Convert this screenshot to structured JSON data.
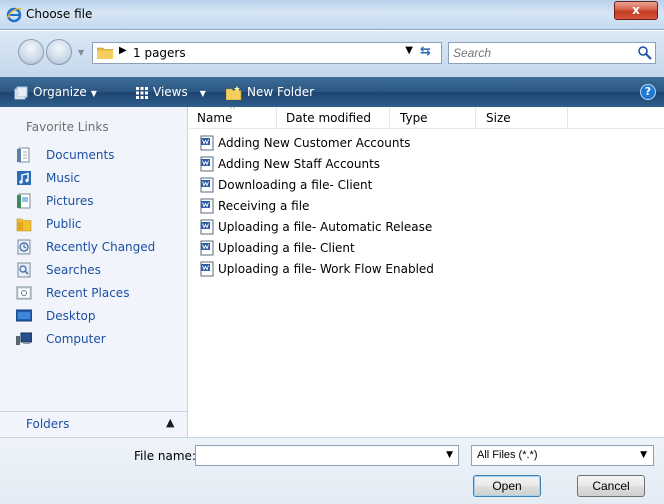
{
  "window": {
    "title": "Choose file",
    "close_label": "x"
  },
  "address": {
    "path": "1 pagers",
    "search_placeholder": "Search"
  },
  "toolbar": {
    "organize": "Organize",
    "views": "Views",
    "new_folder": "New Folder",
    "help": "?"
  },
  "sidebar": {
    "title": "Favorite Links",
    "items": [
      {
        "label": "Documents",
        "icon": "documents-icon"
      },
      {
        "label": "Music",
        "icon": "music-icon"
      },
      {
        "label": "Pictures",
        "icon": "pictures-icon"
      },
      {
        "label": "Public",
        "icon": "public-folder-icon"
      },
      {
        "label": "Recently Changed",
        "icon": "recently-changed-icon"
      },
      {
        "label": "Searches",
        "icon": "searches-icon"
      },
      {
        "label": "Recent Places",
        "icon": "recent-places-icon"
      },
      {
        "label": "Desktop",
        "icon": "desktop-icon"
      },
      {
        "label": "Computer",
        "icon": "computer-icon"
      }
    ],
    "folders_label": "Folders"
  },
  "filelist": {
    "columns": [
      "Name",
      "Date modified",
      "Type",
      "Size"
    ],
    "files": [
      "Adding New Customer Accounts",
      "Adding New Staff Accounts",
      "Downloading a file- Client",
      "Receiving a file",
      "Uploading a file- Automatic Release",
      "Uploading a file- Client",
      "Uploading a file- Work Flow Enabled"
    ]
  },
  "footer": {
    "filename_label": "File name:",
    "filename_value": "",
    "filetype_value": "All Files (*.*)",
    "open_label": "Open",
    "cancel_label": "Cancel"
  },
  "colors": {
    "link": "#1c4fa2",
    "toolbar": "#2a5581",
    "sidebar_bg": "#f1f5fb"
  }
}
